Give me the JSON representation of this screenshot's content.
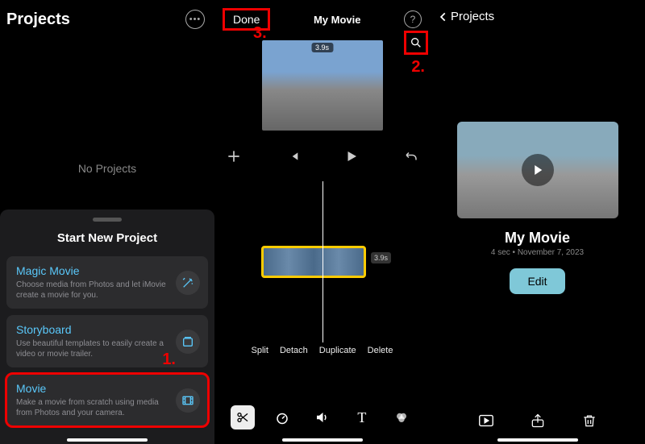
{
  "annotations": {
    "a1": "1.",
    "a2": "2.",
    "a3": "3."
  },
  "panel1": {
    "title": "Projects",
    "empty": "No Projects",
    "sheet_title": "Start New Project",
    "options": [
      {
        "title": "Magic Movie",
        "desc": "Choose media from Photos and let iMovie create a movie for you.",
        "icon": "wand-icon"
      },
      {
        "title": "Storyboard",
        "desc": "Use beautiful templates to easily create a video or movie trailer.",
        "icon": "storyboard-icon"
      },
      {
        "title": "Movie",
        "desc": "Make a movie from scratch using media from Photos and your camera.",
        "icon": "film-icon"
      }
    ]
  },
  "panel2": {
    "done": "Done",
    "title": "My Movie",
    "duration": "3.9s",
    "clip_duration": "3.9s",
    "edit_actions": [
      "Split",
      "Detach",
      "Duplicate",
      "Delete"
    ]
  },
  "panel3": {
    "back": "Projects",
    "name": "My Movie",
    "meta": "4 sec • November 7, 2023",
    "edit": "Edit"
  }
}
